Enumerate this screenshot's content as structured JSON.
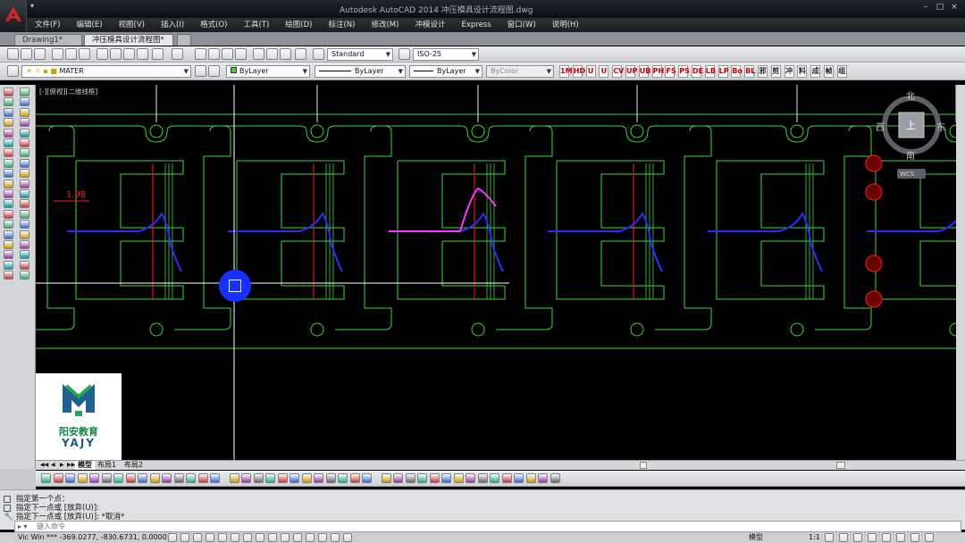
{
  "app": {
    "title": "Autodesk AutoCAD 2014    冲压模具设计流程图.dwg",
    "window_controls": [
      "–",
      "□",
      "×"
    ],
    "qat_arrow": "▾"
  },
  "menu": [
    "文件(F)",
    "编辑(E)",
    "视图(V)",
    "插入(I)",
    "格式(O)",
    "工具(T)",
    "绘图(D)",
    "标注(N)",
    "修改(M)",
    "冲模设计",
    "Express",
    "窗口(W)",
    "说明(H)"
  ],
  "doc_tabs": [
    {
      "label": "Drawing1*",
      "active": false
    },
    {
      "label": "冲压模具设计流程图*",
      "active": true
    }
  ],
  "tab_close": "×",
  "toolbar_standard": {
    "text_style": "Standard",
    "dim_style": "ISO-25"
  },
  "toolbar_layers": {
    "layer": "MATER",
    "color": "ByLayer",
    "linetype": "ByLayer",
    "lineweight": "ByLayer",
    "plotstyle": "ByColor"
  },
  "custom_tools": [
    "1M",
    "HD",
    "U",
    "U",
    "CV",
    "UP",
    "UB",
    "PH",
    "FS",
    "PS",
    "DE",
    "LB",
    "LP",
    "Bo",
    "BL",
    "邪",
    "剪",
    "冲",
    "料",
    "成",
    "帧",
    "组"
  ],
  "viewport_label": "[-][俯视][二维线框]",
  "viewcube": {
    "north": "北",
    "south": "南",
    "east": "东",
    "west": "西",
    "top": "上",
    "wcs": "WCS"
  },
  "dimension_text": "1.98",
  "logo": {
    "line1": "阳安教育",
    "line2": "YAJY"
  },
  "layout_tabs": [
    {
      "label": "模型",
      "active": true
    },
    {
      "label": "布局1",
      "active": false
    },
    {
      "label": "布局2",
      "active": false
    }
  ],
  "layout_nav": [
    "◀◀",
    "◀",
    "▶",
    "▶▶"
  ],
  "command_history": [
    "指定第一个点：",
    "指定下一点或 [放弃(U)]:",
    "指定下一点或 [放弃(U)]: *取消*"
  ],
  "command_placeholder": "键入命令",
  "status": {
    "coords": "Vic Win ***   -369.0277, -830.6731, 0.0000",
    "model": "模型",
    "scale": "1:1"
  },
  "colors": {
    "green": "#3ed33e",
    "red": "#ff1a1a",
    "blue": "#2c2cff",
    "magenta": "#ff33ff",
    "white": "#e6e6e6"
  }
}
